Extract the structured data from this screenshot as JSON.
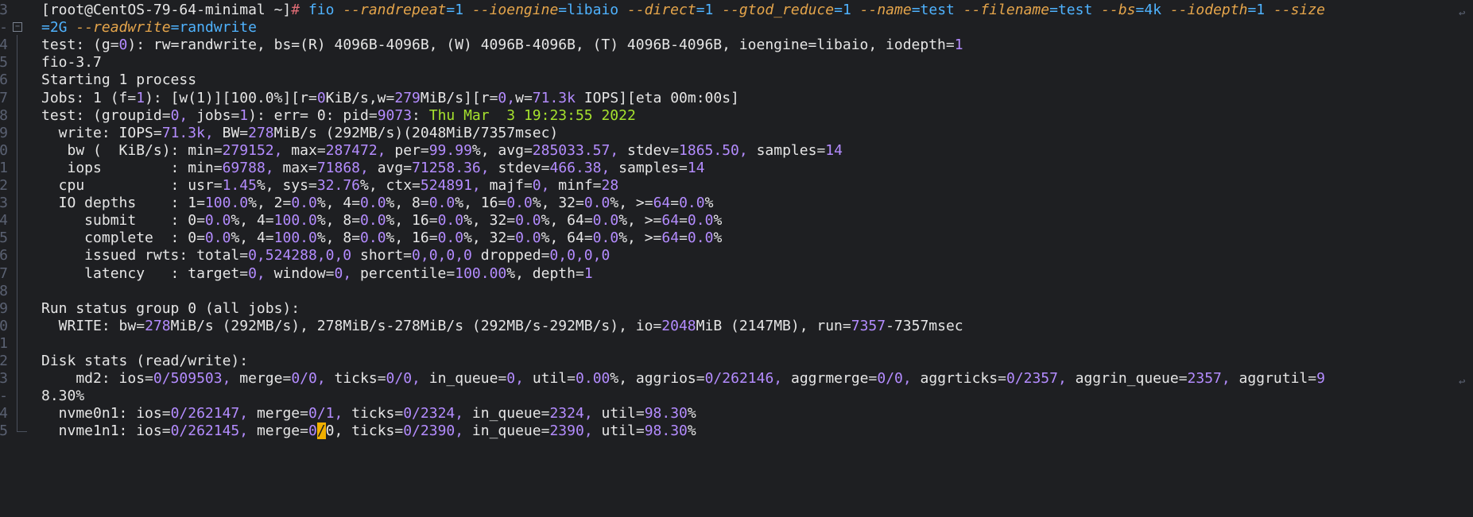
{
  "terminal": {
    "lines": [
      {
        "num": "3",
        "fold": "none",
        "text": "[root@CentOS-79-64-minimal ~]# fio --randrepeat=1 --ioengine=libaio --direct=1 --gtod_reduce=1 --name=test --filename=test --bs=4k --iodepth=1 --size",
        "wrapped": true
      },
      {
        "num": "-",
        "fold": "box",
        "text": "=2G --readwrite=randwrite"
      },
      {
        "num": "4",
        "fold": "bar",
        "text": "test: (g=0): rw=randwrite, bs=(R) 4096B-4096B, (W) 4096B-4096B, (T) 4096B-4096B, ioengine=libaio, iodepth=1"
      },
      {
        "num": "5",
        "fold": "bar",
        "text": "fio-3.7"
      },
      {
        "num": "6",
        "fold": "bar",
        "text": "Starting 1 process"
      },
      {
        "num": "7",
        "fold": "bar",
        "text": "Jobs: 1 (f=1): [w(1)][100.0%][r=0KiB/s,w=279MiB/s][r=0,w=71.3k IOPS][eta 00m:00s]"
      },
      {
        "num": "8",
        "fold": "bar",
        "text": "test: (groupid=0, jobs=1): err= 0: pid=9073: Thu Mar  3 19:23:55 2022"
      },
      {
        "num": "9",
        "fold": "bar",
        "text": "  write: IOPS=71.3k, BW=278MiB/s (292MB/s)(2048MiB/7357msec)"
      },
      {
        "num": "0",
        "fold": "bar",
        "text": "   bw (  KiB/s): min=279152, max=287472, per=99.99%, avg=285033.57, stdev=1865.50, samples=14"
      },
      {
        "num": "1",
        "fold": "bar",
        "text": "   iops        : min=69788, max=71868, avg=71258.36, stdev=466.38, samples=14"
      },
      {
        "num": "2",
        "fold": "bar",
        "text": "  cpu          : usr=1.45%, sys=32.76%, ctx=524891, majf=0, minf=28"
      },
      {
        "num": "3",
        "fold": "bar",
        "text": "  IO depths    : 1=100.0%, 2=0.0%, 4=0.0%, 8=0.0%, 16=0.0%, 32=0.0%, >=64=0.0%"
      },
      {
        "num": "4",
        "fold": "bar",
        "text": "     submit    : 0=0.0%, 4=100.0%, 8=0.0%, 16=0.0%, 32=0.0%, 64=0.0%, >=64=0.0%"
      },
      {
        "num": "5",
        "fold": "bar",
        "text": "     complete  : 0=0.0%, 4=100.0%, 8=0.0%, 16=0.0%, 32=0.0%, 64=0.0%, >=64=0.0%"
      },
      {
        "num": "6",
        "fold": "bar",
        "text": "     issued rwts: total=0,524288,0,0 short=0,0,0,0 dropped=0,0,0,0"
      },
      {
        "num": "7",
        "fold": "bar",
        "text": "     latency   : target=0, window=0, percentile=100.00%, depth=1"
      },
      {
        "num": "8",
        "fold": "bar",
        "text": ""
      },
      {
        "num": "9",
        "fold": "bar",
        "text": "Run status group 0 (all jobs):"
      },
      {
        "num": "0",
        "fold": "bar",
        "text": "  WRITE: bw=278MiB/s (292MB/s), 278MiB/s-278MiB/s (292MB/s-292MB/s), io=2048MiB (2147MB), run=7357-7357msec"
      },
      {
        "num": "1",
        "fold": "bar",
        "text": ""
      },
      {
        "num": "2",
        "fold": "bar",
        "text": "Disk stats (read/write):"
      },
      {
        "num": "3",
        "fold": "bar",
        "text": "    md2: ios=0/509503, merge=0/0, ticks=0/0, in_queue=0, util=0.00%, aggrios=0/262146, aggrmerge=0/0, aggrticks=0/2357, aggrin_queue=2357, aggrutil=9",
        "wrapped": true
      },
      {
        "num": "-",
        "fold": "bar",
        "text": "8.30%"
      },
      {
        "num": "4",
        "fold": "bar",
        "text": "  nvme0n1: ios=0/262147, merge=0/1, ticks=0/2324, in_queue=2324, util=98.30%"
      },
      {
        "num": "5",
        "fold": "corner",
        "text": "  nvme1n1: ios=0/262145, merge=0/0, ticks=0/2390, in_queue=2390, util=98.30%",
        "cursor_index": 32
      }
    ]
  },
  "colors": {
    "background": "#1e1f22",
    "text": "#e6e6e6",
    "command": "#4fb3ff",
    "option": "#e5a54b",
    "number": "#b48cff",
    "timestamp": "#a6e22e",
    "prompt_hash": "#e06c75",
    "gutter": "#5a6172",
    "cursor": "#f0b000"
  },
  "icons": {
    "fold": "fold-toggle-icon",
    "wrap": "line-wrap-icon"
  }
}
